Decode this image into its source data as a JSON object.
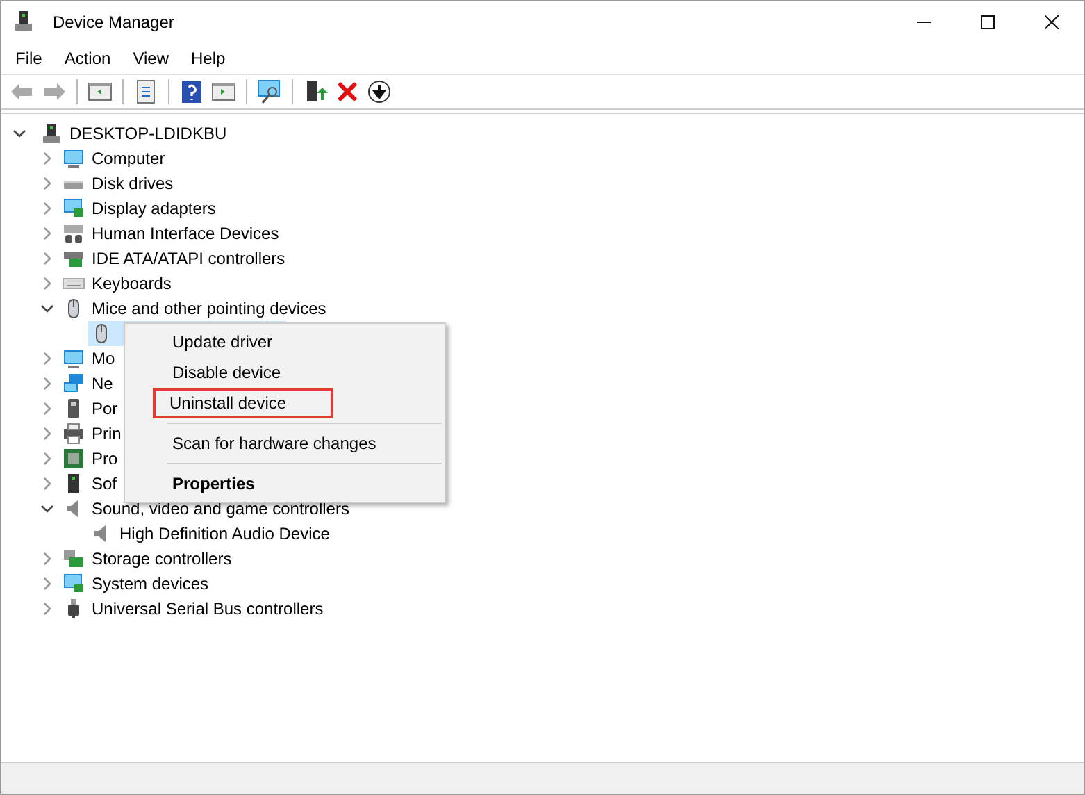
{
  "window": {
    "title": "Device Manager"
  },
  "menu_bar": [
    "File",
    "Action",
    "View",
    "Help"
  ],
  "toolbar": [
    {
      "kind": "back",
      "disabled": true
    },
    {
      "kind": "forward",
      "disabled": true
    },
    {
      "kind": "separator"
    },
    {
      "kind": "pane",
      "disabled": false
    },
    {
      "kind": "separator"
    },
    {
      "kind": "properties",
      "disabled": false
    },
    {
      "kind": "separator"
    },
    {
      "kind": "help",
      "disabled": false
    },
    {
      "kind": "pane2",
      "disabled": false
    },
    {
      "kind": "separator"
    },
    {
      "kind": "scan",
      "disabled": false
    },
    {
      "kind": "separator"
    },
    {
      "kind": "update",
      "disabled": false
    },
    {
      "kind": "uninstall",
      "disabled": false
    },
    {
      "kind": "download",
      "disabled": false
    }
  ],
  "tree": {
    "label": "DESKTOP-LDIDKBU",
    "kind": "computer",
    "expanded": true,
    "children": [
      {
        "label": "Computer",
        "kind": "monitor",
        "expanded": false
      },
      {
        "label": "Disk drives",
        "kind": "disk",
        "expanded": false
      },
      {
        "label": "Display adapters",
        "kind": "display",
        "expanded": false
      },
      {
        "label": "Human Interface Devices",
        "kind": "hid",
        "expanded": false
      },
      {
        "label": "IDE ATA/ATAPI controllers",
        "kind": "ide",
        "expanded": false
      },
      {
        "label": "Keyboards",
        "kind": "keyboard",
        "expanded": false
      },
      {
        "label": "Mice and other pointing devices",
        "kind": "mouse",
        "expanded": true,
        "children": [
          {
            "kind": "mouse",
            "selected": true
          }
        ]
      },
      {
        "label": "Mo",
        "kind": "monitor",
        "expanded": false
      },
      {
        "label": "Ne",
        "kind": "network",
        "expanded": false
      },
      {
        "label": "Por",
        "kind": "port",
        "expanded": false
      },
      {
        "label": "Prin",
        "kind": "printer",
        "expanded": false
      },
      {
        "label": "Pro",
        "kind": "chip",
        "expanded": false
      },
      {
        "label": "Sof",
        "kind": "software",
        "expanded": false
      },
      {
        "label": "Sound, video and game controllers",
        "kind": "speaker",
        "expanded": true,
        "children": [
          {
            "label": "High Definition Audio Device",
            "kind": "speaker",
            "selected": false
          }
        ]
      },
      {
        "label": "Storage controllers",
        "kind": "storage",
        "expanded": false
      },
      {
        "label": "System devices",
        "kind": "display",
        "expanded": false
      },
      {
        "label": "Universal Serial Bus controllers",
        "kind": "usb",
        "expanded": false
      }
    ]
  },
  "context_menu": [
    {
      "kind": "item",
      "label": "Update driver",
      "bold": false,
      "outlined": false
    },
    {
      "kind": "item",
      "label": "Disable device",
      "bold": false,
      "outlined": false
    },
    {
      "kind": "item",
      "label": "Uninstall device",
      "bold": false,
      "outlined": true
    },
    {
      "kind": "separator"
    },
    {
      "kind": "item",
      "label": "Scan for hardware changes",
      "bold": false,
      "outlined": false
    },
    {
      "kind": "separator"
    },
    {
      "kind": "item",
      "label": "Properties",
      "bold": true,
      "outlined": false
    }
  ]
}
